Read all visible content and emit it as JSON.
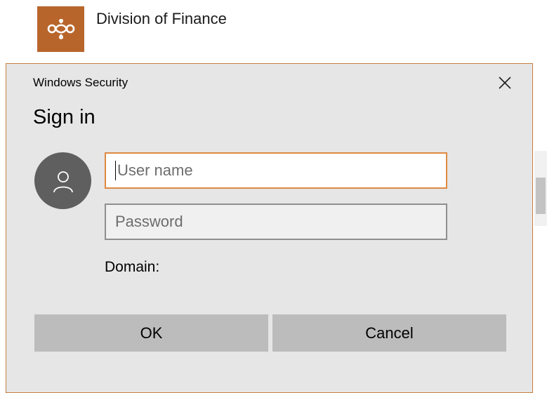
{
  "app": {
    "title": "Division of Finance",
    "logo_icon": "infinity-knot-icon",
    "brand_color": "#b8652c"
  },
  "dialog": {
    "caption": "Windows Security",
    "heading": "Sign in",
    "close_icon": "close-icon",
    "accent_color": "#de8a42",
    "avatar_icon": "user-icon",
    "username": {
      "value": "",
      "placeholder": "User name"
    },
    "password": {
      "value": "",
      "placeholder": "Password"
    },
    "domain_label": "Domain:",
    "ok_label": "OK",
    "cancel_label": "Cancel"
  }
}
